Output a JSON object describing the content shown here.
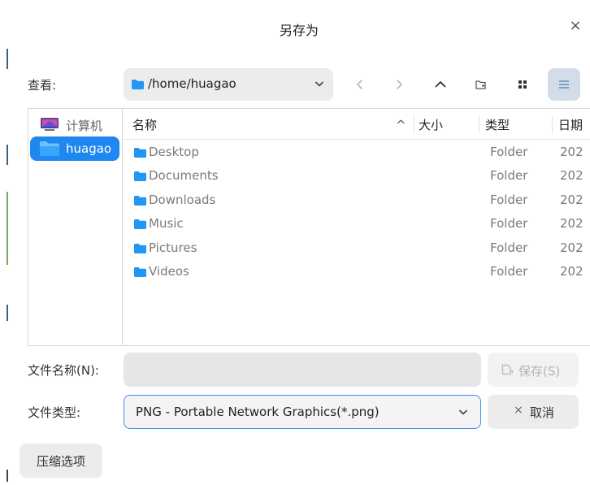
{
  "window": {
    "title": "另存为",
    "close_glyph": "×"
  },
  "lookin": {
    "label": "查看:",
    "path": "/home/huagao"
  },
  "toolbar": {
    "icons": [
      "chevron-down-icon",
      "back-icon",
      "forward-icon",
      "parent-directory-icon",
      "new-folder-icon",
      "grid-view-icon",
      "list-view-icon"
    ]
  },
  "sidebar": {
    "items": [
      {
        "label": "计算机",
        "icon": "computer-icon",
        "selected": false
      },
      {
        "label": "huagao",
        "icon": "home-folder-icon",
        "selected": true
      }
    ]
  },
  "filelist": {
    "columns": [
      "名称",
      "大小",
      "类型",
      "日期"
    ],
    "sort_glyph": "^",
    "rows": [
      {
        "name": "Desktop",
        "type": "Folder",
        "date": "202"
      },
      {
        "name": "Documents",
        "type": "Folder",
        "date": "202"
      },
      {
        "name": "Downloads",
        "type": "Folder",
        "date": "202"
      },
      {
        "name": "Music",
        "type": "Folder",
        "date": "202"
      },
      {
        "name": "Pictures",
        "type": "Folder",
        "date": "202"
      },
      {
        "name": "Videos",
        "type": "Folder",
        "date": "202"
      }
    ]
  },
  "filename": {
    "label": "文件名称(N):",
    "value": ""
  },
  "filetype": {
    "label": "文件类型:",
    "selected": "PNG - Portable Network Graphics(*.png)"
  },
  "buttons": {
    "save": "保存(S)",
    "cancel_glyph": "×",
    "cancel": "取消",
    "compress": "压缩选项"
  },
  "colors": {
    "accent": "#1f87f0",
    "folder": "#2196f3",
    "view_active_bg": "#d3dde9"
  }
}
